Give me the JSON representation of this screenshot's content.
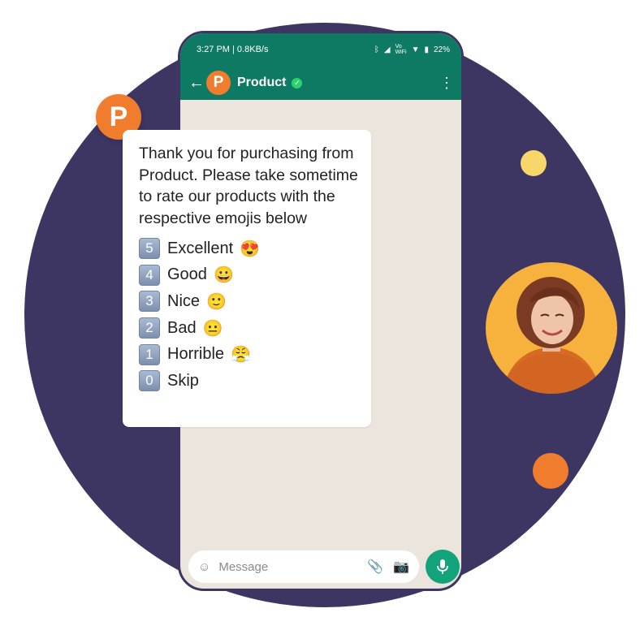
{
  "statusbar": {
    "time_info": "3:27 PM | 0.8KB/s",
    "vowifi": "Vo WiFi",
    "battery": "22%"
  },
  "header": {
    "avatar_letter": "P",
    "title": "Product"
  },
  "brand_badge_letter": "P",
  "message": {
    "text_part1": "Thank you for purchasing from ",
    "brand": "Product.",
    "text_part2": " Please take sometime to rate our products with the respective emojis below",
    "options": [
      {
        "key": "5",
        "label": "Excellent",
        "emoji": "😍"
      },
      {
        "key": "4",
        "label": "Good",
        "emoji": "😀"
      },
      {
        "key": "3",
        "label": "Nice",
        "emoji": "🙂"
      },
      {
        "key": "2",
        "label": "Bad",
        "emoji": "😐"
      },
      {
        "key": "1",
        "label": "Horrible",
        "emoji": "😤"
      },
      {
        "key": "0",
        "label": "Skip",
        "emoji": ""
      }
    ]
  },
  "input": {
    "placeholder": "Message"
  },
  "icons": {
    "back": "arrow-left-icon",
    "menu": "more-vertical-icon",
    "emoji": "smiley-icon",
    "attach": "paperclip-icon",
    "camera": "camera-icon",
    "mic": "microphone-icon"
  },
  "colors": {
    "header": "#0f7a63",
    "brand": "#f07c2e",
    "background_circle": "#3d3562",
    "chat_bg": "#ece5dd",
    "mic_button": "#13a37b"
  }
}
